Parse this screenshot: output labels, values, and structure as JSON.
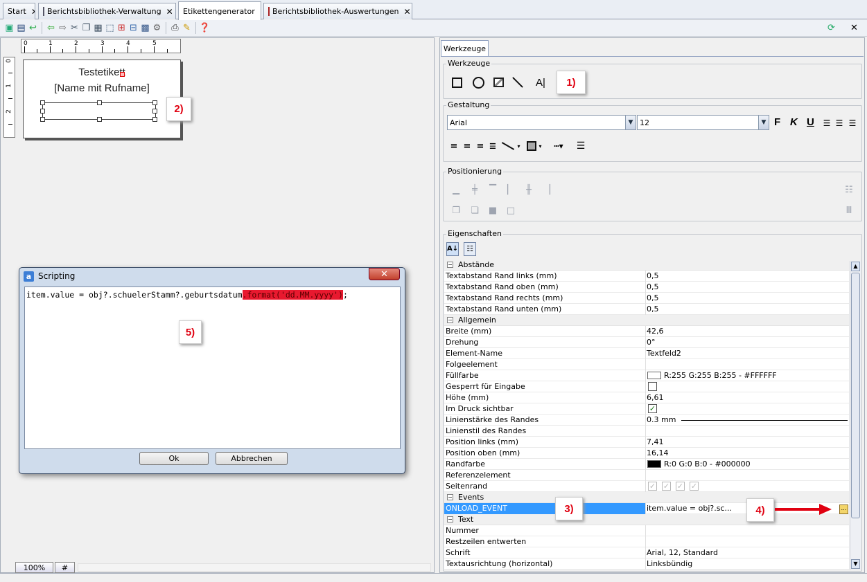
{
  "tabs": [
    {
      "label": "Start"
    },
    {
      "label": "Berichtsbibliothek-Verwaltung"
    },
    {
      "label": "Etikettengenerator"
    },
    {
      "label": "Berichtsbibliothek-Auswertungen"
    }
  ],
  "ruler": {
    "h_numbers": [
      "0",
      "1",
      "2",
      "3",
      "4",
      "5"
    ],
    "v_numbers": [
      "0",
      "1",
      "2"
    ]
  },
  "label_canvas": {
    "line1": "Testetikett",
    "line2": "[Name mit Rufname]"
  },
  "callouts": {
    "c1": "1)",
    "c2": "2)",
    "c3": "3)",
    "c4": "4)",
    "c5": "5)"
  },
  "zoom": {
    "level": "100%",
    "grid": "#"
  },
  "dialog": {
    "title": "Scripting",
    "close": "✕",
    "code_plain": "item.value = obj?.schuelerStamm?.geburtsdatum",
    "code_highlight": ".format('dd.MM.yyyy')",
    "code_end": ";",
    "ok": "Ok",
    "cancel": "Abbrechen"
  },
  "panel": {
    "tab": "Werkzeuge",
    "tools_title": "Werkzeuge",
    "design_title": "Gestaltung",
    "font": "Arial",
    "font_size": "12",
    "bold": "F",
    "italic": "K",
    "underline": "U",
    "position_title": "Positionierung",
    "props_title": "Eigenschaften"
  },
  "properties": [
    {
      "type": "cat",
      "name": "Abstände"
    },
    {
      "name": "Textabstand Rand links (mm)",
      "value": "0,5"
    },
    {
      "name": "Textabstand Rand oben (mm)",
      "value": "0,5"
    },
    {
      "name": "Textabstand Rand rechts (mm)",
      "value": "0,5"
    },
    {
      "name": "Textabstand Rand unten (mm)",
      "value": "0,5"
    },
    {
      "type": "cat",
      "name": "Allgemein"
    },
    {
      "name": "Breite (mm)",
      "value": "42,6"
    },
    {
      "name": "Drehung",
      "value": "0°"
    },
    {
      "name": "Element-Name",
      "value": "Textfeld2"
    },
    {
      "name": "Folgeelement",
      "value": ""
    },
    {
      "name": "Füllfarbe",
      "value": "R:255 G:255 B:255 - #FFFFFF",
      "swatch": "#ffffff"
    },
    {
      "name": "Gesperrt für Eingabe",
      "value": "",
      "check": "off"
    },
    {
      "name": "Höhe (mm)",
      "value": "6,61"
    },
    {
      "name": "Im Druck sichtbar",
      "value": "",
      "check": "on"
    },
    {
      "name": "Linienstärke des Randes",
      "value": "0.3 mm",
      "line": true
    },
    {
      "name": "Linienstil des Randes",
      "value": ""
    },
    {
      "name": "Position links (mm)",
      "value": "7,41"
    },
    {
      "name": "Position oben (mm)",
      "value": "16,14"
    },
    {
      "name": "Randfarbe",
      "value": "R:0 G:0 B:0 - #000000",
      "swatch": "#000000"
    },
    {
      "name": "Referenzelement",
      "value": ""
    },
    {
      "name": "Seitenrand",
      "value": "",
      "checks4": true
    },
    {
      "type": "cat",
      "name": "Events"
    },
    {
      "name": "ONLOAD_EVENT",
      "value": "item.value = obj?.sc...",
      "selected": true
    },
    {
      "type": "cat",
      "name": "Text"
    },
    {
      "name": "Nummer",
      "value": ""
    },
    {
      "name": "Restzeilen entwerten",
      "value": ""
    },
    {
      "name": "Schrift",
      "value": "Arial, 12, Standard"
    },
    {
      "name": "Textausrichtung (horizontal)",
      "value": "Linksbündig"
    }
  ],
  "colors": {
    "callout_red": "#e00010",
    "selection": "#3399ff",
    "highlight": "#e8192f"
  }
}
